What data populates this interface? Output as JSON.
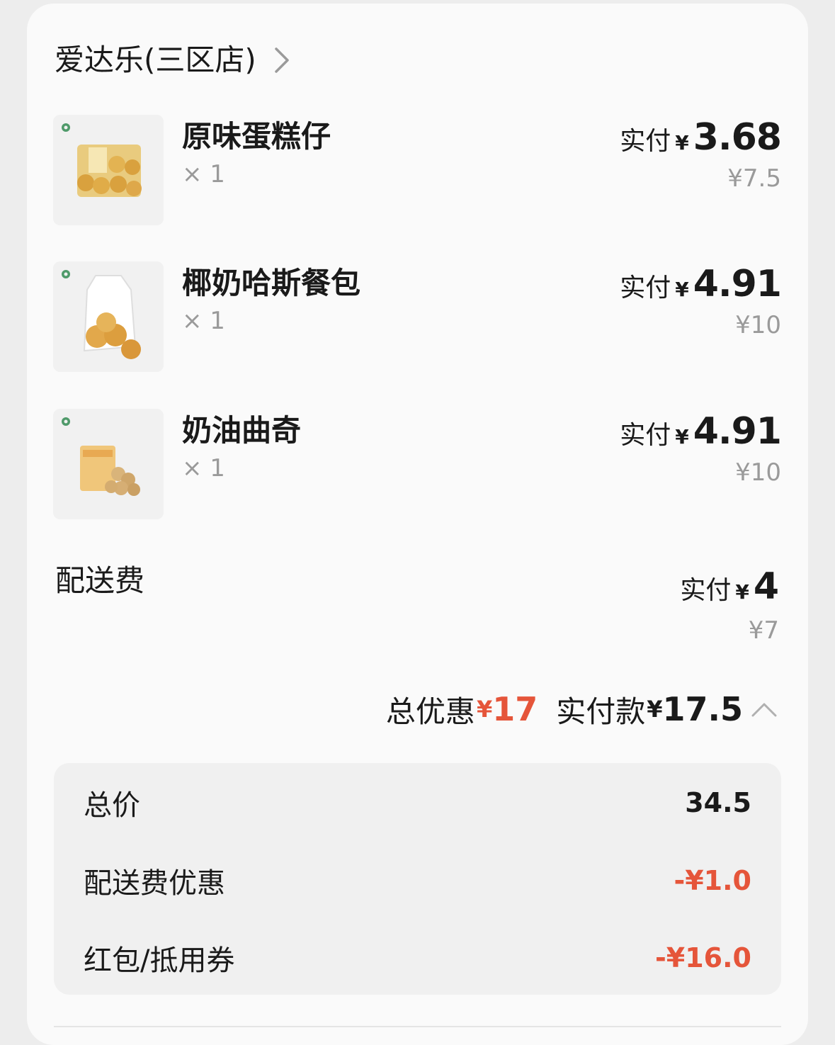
{
  "store": {
    "name": "爱达乐(三区店)",
    "chevron_icon": "chevron-right-icon"
  },
  "items": [
    {
      "name": "原味蛋糕仔",
      "qty": "× 1",
      "paid_label": "实付",
      "paid_symbol": "¥",
      "paid_amount": "3.68",
      "original_price": "¥7.5"
    },
    {
      "name": "椰奶哈斯餐包",
      "qty": "× 1",
      "paid_label": "实付",
      "paid_symbol": "¥",
      "paid_amount": "4.91",
      "original_price": "¥10"
    },
    {
      "name": "奶油曲奇",
      "qty": "× 1",
      "paid_label": "实付",
      "paid_symbol": "¥",
      "paid_amount": "4.91",
      "original_price": "¥10"
    }
  ],
  "delivery": {
    "label": "配送费",
    "paid_label": "实付",
    "paid_symbol": "¥",
    "paid_amount": "4",
    "original_price": "¥7"
  },
  "summary": {
    "discount_label": "总优惠",
    "discount_symbol": "¥",
    "discount_amount": "17",
    "total_label": "实付款",
    "total_symbol": "¥",
    "total_amount": "17.5",
    "collapse_icon": "chevron-up-icon"
  },
  "breakdown": [
    {
      "label": "总价",
      "value": "34.5"
    },
    {
      "label": "配送费优惠",
      "value": "-¥1.0"
    },
    {
      "label": "红包/抵用券",
      "value": "-¥16.0"
    }
  ],
  "colors": {
    "accent_red": "#e5553a",
    "muted_text": "#9a9a9a",
    "card_bg": "#fafafa",
    "breakdown_bg": "#f0f0f0"
  }
}
